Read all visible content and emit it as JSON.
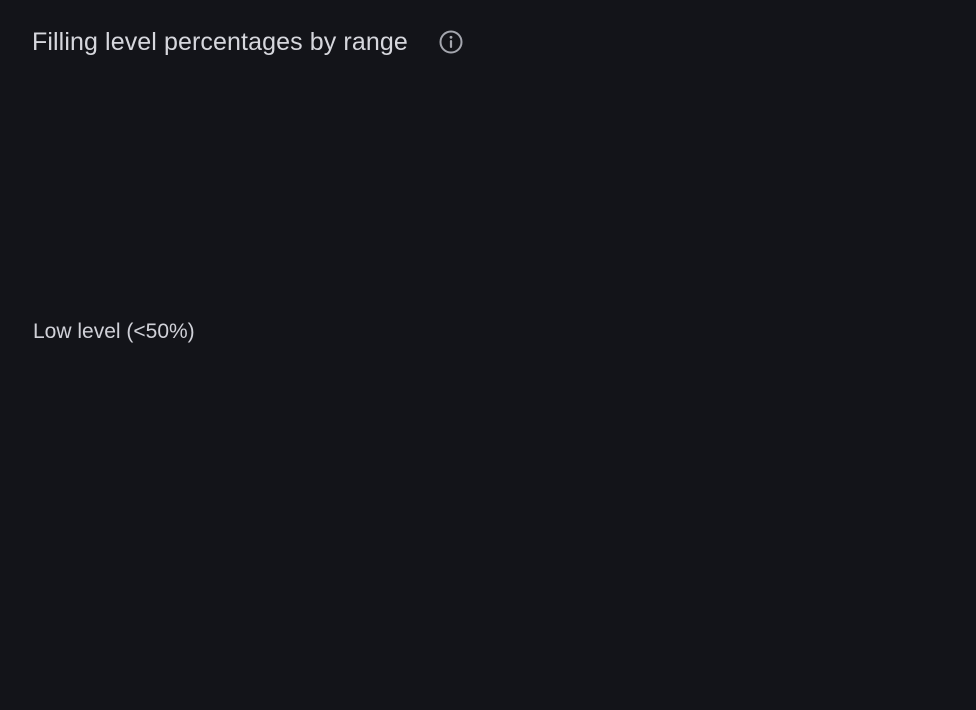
{
  "panel": {
    "title": "Filling level percentages by range",
    "info_icon": "info-circle-icon"
  },
  "content": {
    "range_label": "Low level (<50%)"
  },
  "colors": {
    "background": "#131419",
    "title_text": "#d6d7dd",
    "label_text": "#d0d1d8",
    "icon": "#a4a6ae"
  }
}
